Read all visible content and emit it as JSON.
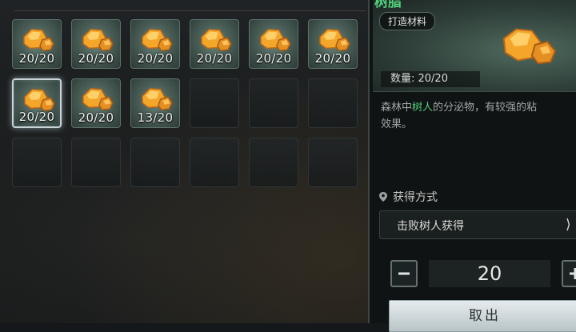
{
  "inventory": {
    "slots": [
      {
        "count": "20/20",
        "filled": true
      },
      {
        "count": "20/20",
        "filled": true
      },
      {
        "count": "20/20",
        "filled": true
      },
      {
        "count": "20/20",
        "filled": true
      },
      {
        "count": "20/20",
        "filled": true
      },
      {
        "count": "20/20",
        "filled": true
      },
      {
        "count": "20/20",
        "filled": true,
        "selected": true
      },
      {
        "count": "20/20",
        "filled": true
      },
      {
        "count": "13/20",
        "filled": true
      },
      {
        "filled": false
      },
      {
        "filled": false
      },
      {
        "filled": false
      },
      {
        "filled": false
      },
      {
        "filled": false
      },
      {
        "filled": false
      },
      {
        "filled": false
      },
      {
        "filled": false
      },
      {
        "filled": false
      }
    ]
  },
  "detail": {
    "title": "树脂",
    "category": "打造材料",
    "quantity": "数量: 20/20",
    "desc_prefix": "森林中",
    "desc_highlight": "树人",
    "desc_suffix": "的分泌物，有较强的粘",
    "desc_line2": "效果。",
    "source_label": "获得方式",
    "source_item": "击败树人获得",
    "amount": "20",
    "take_button": "取出"
  },
  "colors": {
    "highlight_green": "#52d07c",
    "ore_orange": "#f2a22a"
  },
  "icons": [
    "resin-ore-icon",
    "location-pin-icon",
    "navigate-arrow-icon",
    "minus-icon",
    "plus-icon"
  ]
}
